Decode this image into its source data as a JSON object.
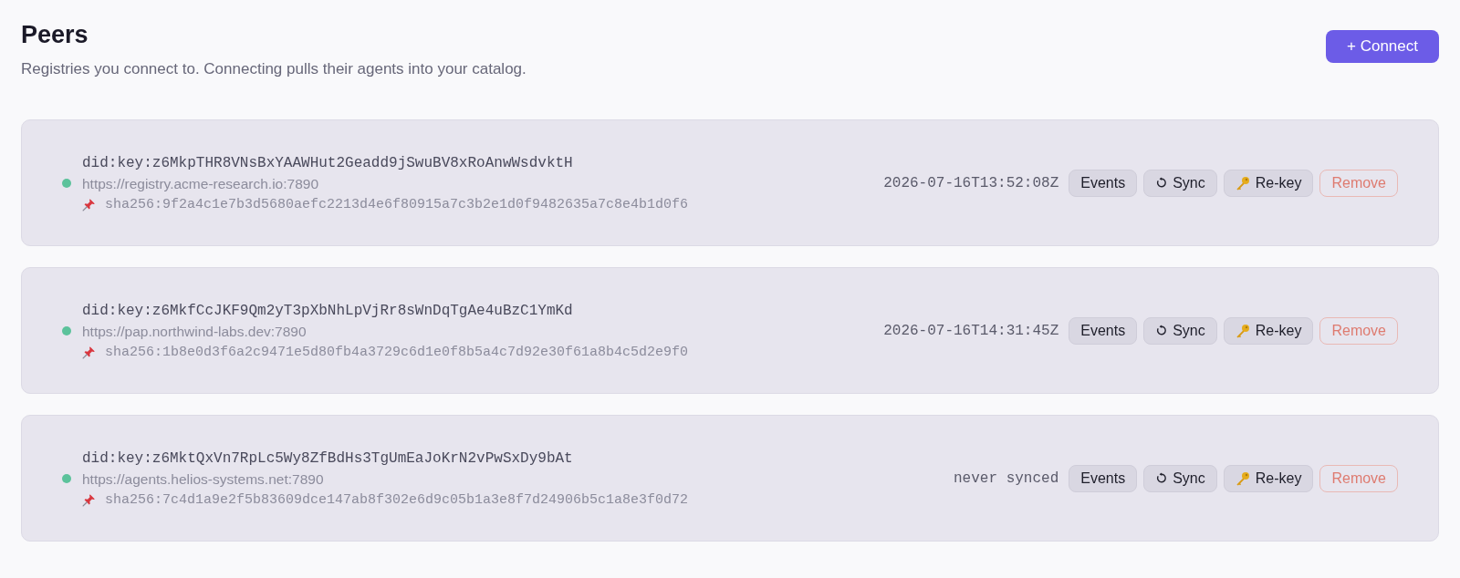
{
  "header": {
    "title": "Peers",
    "subtitle": "Registries you connect to. Connecting pulls their agents into your catalog.",
    "connect_button": "+ Connect"
  },
  "peers": [
    {
      "did": "did:key:z6MkpTHR8VNsBxYAAWHut2Geadd9jSwuBV8xRoAnwWsdvktH",
      "url": "https://registry.acme-research.io:7890",
      "pin": "sha256:9f2a4c1e7b3d5680aefc2213d4e6f80915a7c3b2e1d0f9482635a7c8e4b1d0f6",
      "last_sync": "2026-07-16T13:52:08Z",
      "color": "#5cc29b",
      "actions": [
        {
          "kind": "events",
          "label": "Events"
        },
        {
          "kind": "sync",
          "label": "Sync"
        },
        {
          "kind": "rekey",
          "label": "Re-key"
        },
        {
          "kind": "remove",
          "label": "Remove"
        }
      ]
    },
    {
      "did": "did:key:z6MkfCcJKF9Qm2yT3pXbNhLpVjRr8sWnDqTgAe4uBzC1YmKd",
      "url": "https://pap.northwind-labs.dev:7890",
      "pin": "sha256:1b8e0d3f6a2c9471e5d80fb4a3729c6d1e0f8b5a4c7d92e30f61a8b4c5d2e9f0",
      "last_sync": "2026-07-16T14:31:45Z",
      "color": "#5cc29b",
      "actions": [
        {
          "kind": "events",
          "label": "Events"
        },
        {
          "kind": "sync",
          "label": "Sync"
        },
        {
          "kind": "rekey",
          "label": "Re-key"
        },
        {
          "kind": "remove",
          "label": "Remove"
        }
      ]
    },
    {
      "did": "did:key:z6MktQxVn7RpLc5Wy8ZfBdHs3TgUmEaJoKrN2vPwSxDy9bAt",
      "url": "https://agents.helios-systems.net:7890",
      "pin": "sha256:7c4d1a9e2f5b83609dce147ab8f302e6d9c05b1a3e8f7d24906b5c1a8e3f0d72",
      "last_sync": "never synced",
      "color": "#5cc29b",
      "actions": [
        {
          "kind": "events",
          "label": "Events"
        },
        {
          "kind": "sync",
          "label": "Sync"
        },
        {
          "kind": "rekey",
          "label": "Re-key"
        },
        {
          "kind": "remove",
          "label": "Remove"
        }
      ]
    }
  ]
}
